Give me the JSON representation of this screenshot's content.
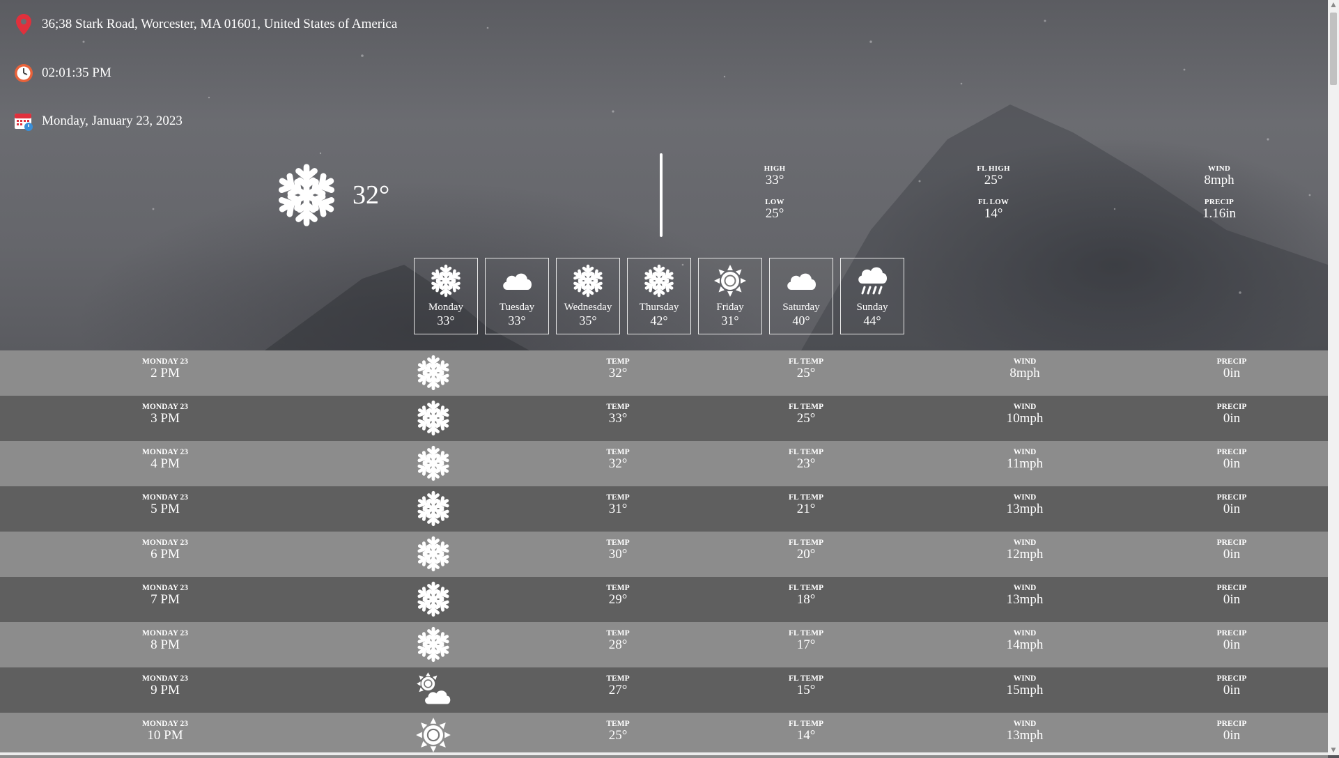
{
  "location": {
    "address": "36;38 Stark Road, Worcester, MA 01601, United States of America",
    "icon": "map-pin-icon"
  },
  "time": {
    "value": "02:01:35 PM",
    "icon": "clock-icon"
  },
  "date": {
    "value": "Monday, January 23, 2023",
    "icon": "calendar-icon"
  },
  "current": {
    "condition_icon": "snowflake-icon",
    "temp": "32°"
  },
  "stats": {
    "high_label": "HIGH",
    "high": "33°",
    "low_label": "LOW",
    "low": "25°",
    "fl_high_label": "FL HIGH",
    "fl_high": "25°",
    "fl_low_label": "FL LOW",
    "fl_low": "14°",
    "wind_label": "WIND",
    "wind": "8mph",
    "precip_label": "PRECIP",
    "precip": "1.16in"
  },
  "forecast": [
    {
      "day": "Monday",
      "temp": "33°",
      "icon": "snowflake-icon"
    },
    {
      "day": "Tuesday",
      "temp": "33°",
      "icon": "cloud-icon"
    },
    {
      "day": "Wednesday",
      "temp": "35°",
      "icon": "snowflake-icon"
    },
    {
      "day": "Thursday",
      "temp": "42°",
      "icon": "snowflake-icon"
    },
    {
      "day": "Friday",
      "temp": "31°",
      "icon": "sun-icon"
    },
    {
      "day": "Saturday",
      "temp": "40°",
      "icon": "cloud-icon"
    },
    {
      "day": "Sunday",
      "temp": "44°",
      "icon": "rain-icon"
    }
  ],
  "hourly_labels": {
    "temp": "TEMP",
    "fl_temp": "FL TEMP",
    "wind": "WIND",
    "precip": "PRECIP"
  },
  "hourly": [
    {
      "date": "MONDAY 23",
      "hour": "2 PM",
      "icon": "snowflake-icon",
      "temp": "32°",
      "fl_temp": "25°",
      "wind": "8mph",
      "precip": "0in"
    },
    {
      "date": "MONDAY 23",
      "hour": "3 PM",
      "icon": "snowflake-icon",
      "temp": "33°",
      "fl_temp": "25°",
      "wind": "10mph",
      "precip": "0in"
    },
    {
      "date": "MONDAY 23",
      "hour": "4 PM",
      "icon": "snowflake-icon",
      "temp": "32°",
      "fl_temp": "23°",
      "wind": "11mph",
      "precip": "0in"
    },
    {
      "date": "MONDAY 23",
      "hour": "5 PM",
      "icon": "snowflake-icon",
      "temp": "31°",
      "fl_temp": "21°",
      "wind": "13mph",
      "precip": "0in"
    },
    {
      "date": "MONDAY 23",
      "hour": "6 PM",
      "icon": "snowflake-icon",
      "temp": "30°",
      "fl_temp": "20°",
      "wind": "12mph",
      "precip": "0in"
    },
    {
      "date": "MONDAY 23",
      "hour": "7 PM",
      "icon": "snowflake-icon",
      "temp": "29°",
      "fl_temp": "18°",
      "wind": "13mph",
      "precip": "0in"
    },
    {
      "date": "MONDAY 23",
      "hour": "8 PM",
      "icon": "snowflake-icon",
      "temp": "28°",
      "fl_temp": "17°",
      "wind": "14mph",
      "precip": "0in"
    },
    {
      "date": "MONDAY 23",
      "hour": "9 PM",
      "icon": "sun-cloud-icon",
      "temp": "27°",
      "fl_temp": "15°",
      "wind": "15mph",
      "precip": "0in"
    },
    {
      "date": "MONDAY 23",
      "hour": "10 PM",
      "icon": "sun-icon",
      "temp": "25°",
      "fl_temp": "14°",
      "wind": "13mph",
      "precip": "0in"
    }
  ],
  "colors": {
    "row_light": "#8c8c8c",
    "row_dark": "#5f5f5f",
    "pin": "#e0303c",
    "clock": "#e8623a"
  }
}
